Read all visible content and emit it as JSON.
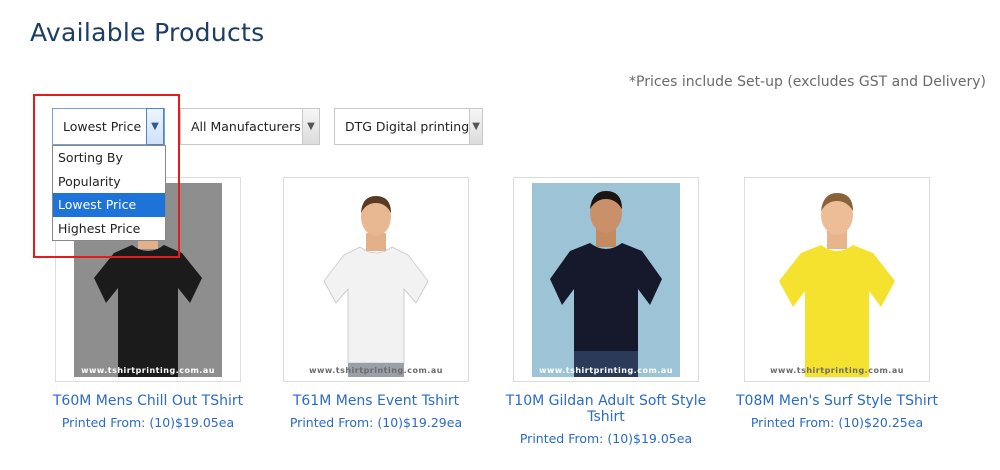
{
  "page": {
    "title": "Available Products",
    "price_note": "*Prices include Set-up (excludes GST and Delivery)"
  },
  "filters": {
    "sort": {
      "selected": "Lowest Price",
      "options": [
        "Sorting By",
        "Popularity",
        "Lowest Price",
        "Highest Price"
      ]
    },
    "manufacturer": {
      "selected": "All Manufacturers"
    },
    "print_method": {
      "selected": "DTG Digital printing"
    }
  },
  "products": [
    {
      "name": "T60M Mens Chill Out TShirt",
      "price": "Printed From: (10)$19.05ea",
      "watermark": "www.tshirtprinting.com.au",
      "shirt_color": "#1b1b1b",
      "bg_color": "#8e8e8e"
    },
    {
      "name": "T61M Mens Event Tshirt",
      "price": "Printed From: (10)$19.29ea",
      "watermark": "www.tshirtprinting.com.au",
      "shirt_color": "#f2f2f2",
      "bg_color": "#ffffff"
    },
    {
      "name": "T10M Gildan Adult Soft Style Tshirt",
      "price": "Printed From: (10)$19.05ea",
      "watermark": "www.tshirtprinting.com.au",
      "shirt_color": "#15192b",
      "bg_color": "#9cc3d6"
    },
    {
      "name": "T08M Men's Surf Style TShirt",
      "price": "Printed From: (10)$20.25ea",
      "watermark": "www.tshirtprinting.com.au",
      "shirt_color": "#f5e22e",
      "bg_color": "#ffffff"
    }
  ]
}
